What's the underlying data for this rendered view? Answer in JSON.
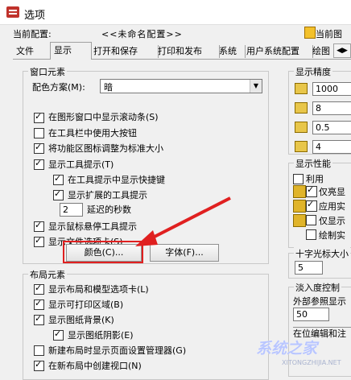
{
  "window": {
    "title": "选项"
  },
  "profile": {
    "label": "当前配置:",
    "value": "<<未命名配置>>",
    "right_label": "当前图"
  },
  "tabs": [
    {
      "label": "文件"
    },
    {
      "label": "显示"
    },
    {
      "label": "打开和保存"
    },
    {
      "label": "打印和发布"
    },
    {
      "label": "系统"
    },
    {
      "label": "用户系统配置"
    },
    {
      "label": "绘图"
    },
    {
      "label": "三"
    }
  ],
  "window_elements": {
    "title": "窗口元素",
    "color_scheme_label": "配色方案(M):",
    "color_scheme_value": "暗",
    "checkboxes": [
      {
        "label": "在图形窗口中显示滚动条(S)",
        "checked": true
      },
      {
        "label": "在工具栏中使用大按钮",
        "checked": false
      },
      {
        "label": "将功能区图标调整为标准大小",
        "checked": true
      },
      {
        "label": "显示工具提示(T)",
        "checked": true
      },
      {
        "label": "在工具提示中显示快捷键",
        "checked": true
      },
      {
        "label": "显示扩展的工具提示",
        "checked": true
      }
    ],
    "delay_value": "2",
    "delay_label": "延迟的秒数",
    "checkboxes2": [
      {
        "label": "显示鼠标悬停工具提示",
        "checked": true
      },
      {
        "label": "显示文件选项卡(S)",
        "checked": true
      }
    ],
    "color_button": "颜色(C)...",
    "font_button": "字体(F)..."
  },
  "layout_elements": {
    "title": "布局元素",
    "checkboxes": [
      {
        "label": "显示布局和模型选项卡(L)",
        "checked": true
      },
      {
        "label": "显示可打印区域(B)",
        "checked": true
      },
      {
        "label": "显示图纸背景(K)",
        "checked": true
      },
      {
        "label": "显示图纸阴影(E)",
        "checked": true
      },
      {
        "label": "新建布局时显示页面设置管理器(G)",
        "checked": false
      },
      {
        "label": "在新布局中创建视口(N)",
        "checked": true
      }
    ]
  },
  "display_resolution": {
    "title": "显示精度",
    "values": [
      "1000",
      "8",
      "0.5",
      "4"
    ]
  },
  "display_performance": {
    "title": "显示性能",
    "items": [
      {
        "label": "利用",
        "checked": false
      },
      {
        "label": "仅亮显",
        "checked": true
      },
      {
        "label": "应用实",
        "checked": true
      },
      {
        "label": "仅显示",
        "checked": false
      },
      {
        "label": "绘制实",
        "checked": false
      }
    ]
  },
  "crosshair": {
    "title": "十字光标大小",
    "value": "5"
  },
  "fade": {
    "title": "淡入度控制",
    "xref_label": "外部参照显示",
    "xref_value": "50",
    "inplace_label": "在位编辑和注"
  },
  "watermark": {
    "text": "系统之家",
    "sub": "XITONGZHIJIA.NET"
  },
  "colors": {
    "annotation": "#e02020"
  }
}
